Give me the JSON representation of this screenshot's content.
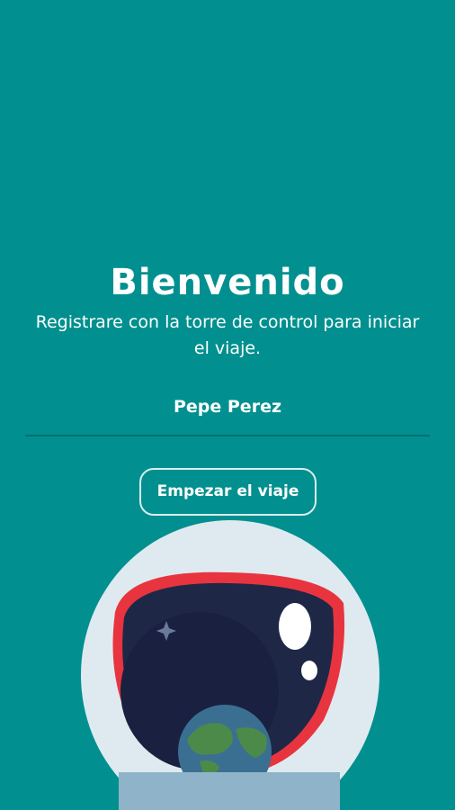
{
  "welcome": {
    "title": "Bienvenido",
    "subtitle": "Registrare con la torre de control para iniciar el viaje."
  },
  "name_field": {
    "value": "Pepe Perez"
  },
  "start_button": {
    "label": "Empezar el viaje"
  },
  "illustration": {
    "icon": "astronaut-helmet-illustration"
  },
  "colors": {
    "background": "#01908f",
    "helmet_outer": "#dfeaf0",
    "visor_rim": "#e8343f",
    "visor_space": "#1e2846",
    "suit_collar": "#8fb3c9"
  }
}
